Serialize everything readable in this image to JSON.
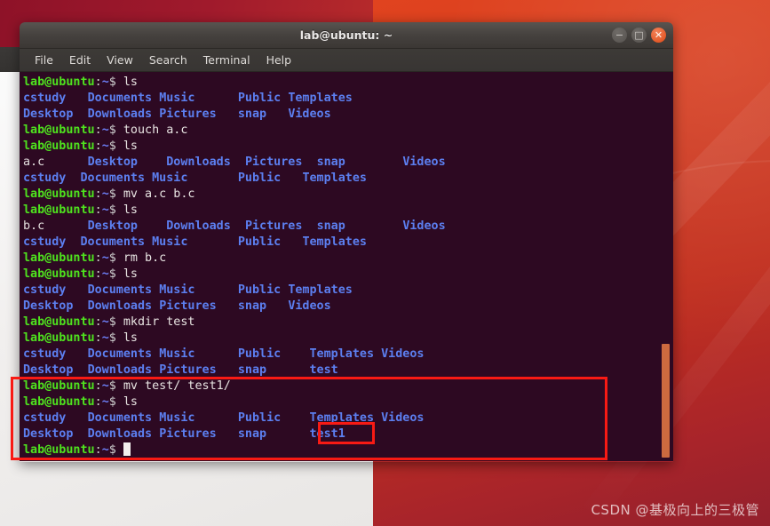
{
  "window": {
    "title": "lab@ubuntu: ~",
    "controls": [
      {
        "name": "minimize",
        "glyph": "−"
      },
      {
        "name": "maximize",
        "glyph": "□"
      },
      {
        "name": "close",
        "glyph": "✕"
      }
    ]
  },
  "menubar": {
    "items": [
      "File",
      "Edit",
      "View",
      "Search",
      "Terminal",
      "Help"
    ]
  },
  "terminal": {
    "prompt": {
      "user": "lab@ubuntu",
      "colon": ":",
      "path": "~",
      "dollar": "$"
    },
    "lines": [
      {
        "type": "prompt",
        "command": "ls"
      },
      {
        "type": "output",
        "cells": [
          {
            "t": "cstudy",
            "k": "dir",
            "w": 9
          },
          {
            "t": "Documents",
            "k": "dir",
            "w": 10
          },
          {
            "t": "Music",
            "k": "dir",
            "w": 11
          },
          {
            "t": "Public",
            "k": "dir",
            "w": 7
          },
          {
            "t": "Templates",
            "k": "dir",
            "w": 9
          }
        ]
      },
      {
        "type": "output",
        "cells": [
          {
            "t": "Desktop",
            "k": "dir",
            "w": 9
          },
          {
            "t": "Downloads",
            "k": "dir",
            "w": 10
          },
          {
            "t": "Pictures",
            "k": "dir",
            "w": 11
          },
          {
            "t": "snap",
            "k": "dir",
            "w": 7
          },
          {
            "t": "Videos",
            "k": "dir",
            "w": 9
          }
        ]
      },
      {
        "type": "prompt",
        "command": "touch a.c"
      },
      {
        "type": "prompt",
        "command": "ls"
      },
      {
        "type": "output",
        "cells": [
          {
            "t": "a.c",
            "k": "file",
            "w": 9
          },
          {
            "t": "Desktop",
            "k": "dir",
            "w": 11
          },
          {
            "t": "Downloads",
            "k": "dir",
            "w": 11
          },
          {
            "t": "Pictures",
            "k": "dir",
            "w": 10
          },
          {
            "t": "snap",
            "k": "dir",
            "w": 12
          },
          {
            "t": "Videos",
            "k": "dir",
            "w": 7
          }
        ]
      },
      {
        "type": "output",
        "cells": [
          {
            "t": "cstudy",
            "k": "dir",
            "w": 8
          },
          {
            "t": "Documents",
            "k": "dir",
            "w": 10
          },
          {
            "t": "Music",
            "k": "dir",
            "w": 12
          },
          {
            "t": "Public",
            "k": "dir",
            "w": 9
          },
          {
            "t": "Templates",
            "k": "dir",
            "w": 10
          }
        ]
      },
      {
        "type": "prompt",
        "command": "mv a.c b.c"
      },
      {
        "type": "prompt",
        "command": "ls"
      },
      {
        "type": "output",
        "cells": [
          {
            "t": "b.c",
            "k": "file",
            "w": 9
          },
          {
            "t": "Desktop",
            "k": "dir",
            "w": 11
          },
          {
            "t": "Downloads",
            "k": "dir",
            "w": 11
          },
          {
            "t": "Pictures",
            "k": "dir",
            "w": 10
          },
          {
            "t": "snap",
            "k": "dir",
            "w": 12
          },
          {
            "t": "Videos",
            "k": "dir",
            "w": 7
          }
        ]
      },
      {
        "type": "output",
        "cells": [
          {
            "t": "cstudy",
            "k": "dir",
            "w": 8
          },
          {
            "t": "Documents",
            "k": "dir",
            "w": 10
          },
          {
            "t": "Music",
            "k": "dir",
            "w": 12
          },
          {
            "t": "Public",
            "k": "dir",
            "w": 9
          },
          {
            "t": "Templates",
            "k": "dir",
            "w": 10
          }
        ]
      },
      {
        "type": "prompt",
        "command": "rm b.c"
      },
      {
        "type": "prompt",
        "command": "ls"
      },
      {
        "type": "output",
        "cells": [
          {
            "t": "cstudy",
            "k": "dir",
            "w": 9
          },
          {
            "t": "Documents",
            "k": "dir",
            "w": 10
          },
          {
            "t": "Music",
            "k": "dir",
            "w": 11
          },
          {
            "t": "Public",
            "k": "dir",
            "w": 7
          },
          {
            "t": "Templates",
            "k": "dir",
            "w": 9
          }
        ]
      },
      {
        "type": "output",
        "cells": [
          {
            "t": "Desktop",
            "k": "dir",
            "w": 9
          },
          {
            "t": "Downloads",
            "k": "dir",
            "w": 10
          },
          {
            "t": "Pictures",
            "k": "dir",
            "w": 11
          },
          {
            "t": "snap",
            "k": "dir",
            "w": 7
          },
          {
            "t": "Videos",
            "k": "dir",
            "w": 9
          }
        ]
      },
      {
        "type": "prompt",
        "command": "mkdir test"
      },
      {
        "type": "prompt",
        "command": "ls"
      },
      {
        "type": "output",
        "cells": [
          {
            "t": "cstudy",
            "k": "dir",
            "w": 9
          },
          {
            "t": "Documents",
            "k": "dir",
            "w": 10
          },
          {
            "t": "Music",
            "k": "dir",
            "w": 11
          },
          {
            "t": "Public",
            "k": "dir",
            "w": 10
          },
          {
            "t": "Templates",
            "k": "dir",
            "w": 10
          },
          {
            "t": "Videos",
            "k": "dir",
            "w": 7
          }
        ]
      },
      {
        "type": "output",
        "cells": [
          {
            "t": "Desktop",
            "k": "dir",
            "w": 9
          },
          {
            "t": "Downloads",
            "k": "dir",
            "w": 10
          },
          {
            "t": "Pictures",
            "k": "dir",
            "w": 11
          },
          {
            "t": "snap",
            "k": "dir",
            "w": 10
          },
          {
            "t": "test",
            "k": "dir",
            "w": 10
          }
        ]
      },
      {
        "type": "prompt",
        "command": "mv test/ test1/"
      },
      {
        "type": "prompt",
        "command": "ls"
      },
      {
        "type": "output",
        "cells": [
          {
            "t": "cstudy",
            "k": "dir",
            "w": 9
          },
          {
            "t": "Documents",
            "k": "dir",
            "w": 10
          },
          {
            "t": "Music",
            "k": "dir",
            "w": 11
          },
          {
            "t": "Public",
            "k": "dir",
            "w": 10
          },
          {
            "t": "Templates",
            "k": "dir",
            "w": 10
          },
          {
            "t": "Videos",
            "k": "dir",
            "w": 7
          }
        ]
      },
      {
        "type": "output",
        "cells": [
          {
            "t": "Desktop",
            "k": "dir",
            "w": 9
          },
          {
            "t": "Downloads",
            "k": "dir",
            "w": 10
          },
          {
            "t": "Pictures",
            "k": "dir",
            "w": 11
          },
          {
            "t": "snap",
            "k": "dir",
            "w": 10
          },
          {
            "t": "test1",
            "k": "dir",
            "w": 10
          }
        ]
      },
      {
        "type": "prompt",
        "command": "",
        "cursor": true
      }
    ]
  },
  "annotations": {
    "color": "#f81a14",
    "outer_label": "highlighted-command-block",
    "inner_label": "renamed-directory-test1"
  },
  "watermark": {
    "text": "CSDN @基极向上的三极管"
  }
}
